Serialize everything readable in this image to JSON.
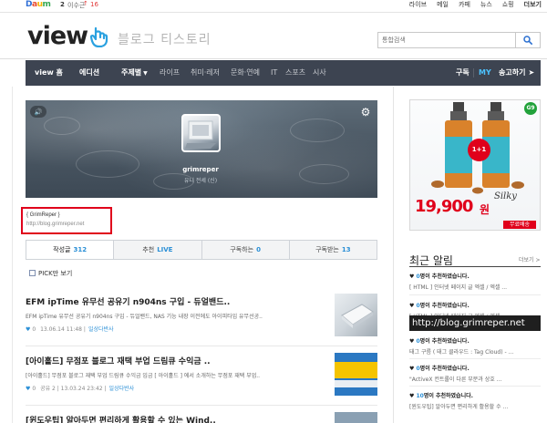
{
  "topbar": {
    "logo": "Daum",
    "rank_number": "2",
    "rank_text": "이수근",
    "rank_arrow": "↑",
    "rank_change": "16",
    "links": [
      "라이브",
      "메일",
      "카페",
      "뉴스",
      "쇼핑",
      "더보기"
    ]
  },
  "header": {
    "logo": "view",
    "tagline": "블로그 티스토리",
    "search_placeholder": "통합검색"
  },
  "nav": {
    "home": "view 홈",
    "edition": "에디션",
    "topic": "주제별",
    "categories": [
      "라이프",
      "취미·레저",
      "문화·연예",
      "IT",
      "스포츠",
      "시사"
    ],
    "subscribe": "구독",
    "my": "MY",
    "send": "송고하기"
  },
  "cover": {
    "nickname": "grimreper",
    "subtitle": "유니 전세 (신)"
  },
  "blog_info": {
    "name": "{ GrimReper }",
    "url": "http://blog.grimreper.net"
  },
  "tabs": [
    {
      "label": "작성글",
      "count": "312"
    },
    {
      "label": "추천",
      "count": "LIVE"
    },
    {
      "label": "구독하는",
      "count": "0"
    },
    {
      "label": "구독받는",
      "count": "13"
    }
  ],
  "pick_label": "PICK만 보기",
  "posts": [
    {
      "title": "EFM ipTime 유무선 공유기 n904ns 구입 - 듀얼밴드..",
      "summary": "EFM ipTime 유무선 공유기 n904ns 구입 - 듀얼밴드, NAS 기능 내장 이전에도 아이피타임 유무선공..",
      "who": "0",
      "date": "13.06.14 11:48",
      "category": "일상다반사"
    },
    {
      "title": "[아이홀드] 무점포 블로그 재택 부업 드림큐 수익금 ..",
      "summary": "[아이홀드] 무점포 블로그 재택 부업 드림큐 수익금 입금 [ 아이홀드 ] 에서 소개하는 무점포 재택 부업..",
      "who": "0",
      "date": "공유 2 | 13.03.24 23:42",
      "category": "일상다반사"
    },
    {
      "title": "[윈도우팁] 알아두면 편리하게 활용할 수 있는 Wind.."
    }
  ],
  "ad": {
    "price": "19,900",
    "won": "원",
    "brand": "Silky",
    "shipping": "무료배송",
    "badge": "1+1",
    "mark": "G9"
  },
  "notifications": {
    "title": "최근 알림",
    "more": "더보기 >",
    "items": [
      {
        "who": "0",
        "head": "명이 추천하였습니다.",
        "body": "[ HTML ] 인터넷 페이지 글 엑셀 / 엑셀 ..."
      },
      {
        "who": "0",
        "head": "명이 추천하였습니다.",
        "body": "[ HTML ] 인터넷 페이지 글 엑셀 / 엑셀 ..."
      },
      {
        "who": "0",
        "head": "명이 추천하였습니다.",
        "body": "태그 구름 ( 태그 클라우드 : Tag Cloud) - ..."
      },
      {
        "who": "0",
        "head": "명이 추천하였습니다.",
        "body": "\"ActiveX 컨트롤이 다른 부분과 상호 ..."
      },
      {
        "who": "10",
        "head": "명이 추천하였습니다.",
        "body": "[윈도우팁] 알아두면 편리하게 활용할 수 ..."
      }
    ]
  },
  "url_tooltip": "http://blog.grimreper.net"
}
